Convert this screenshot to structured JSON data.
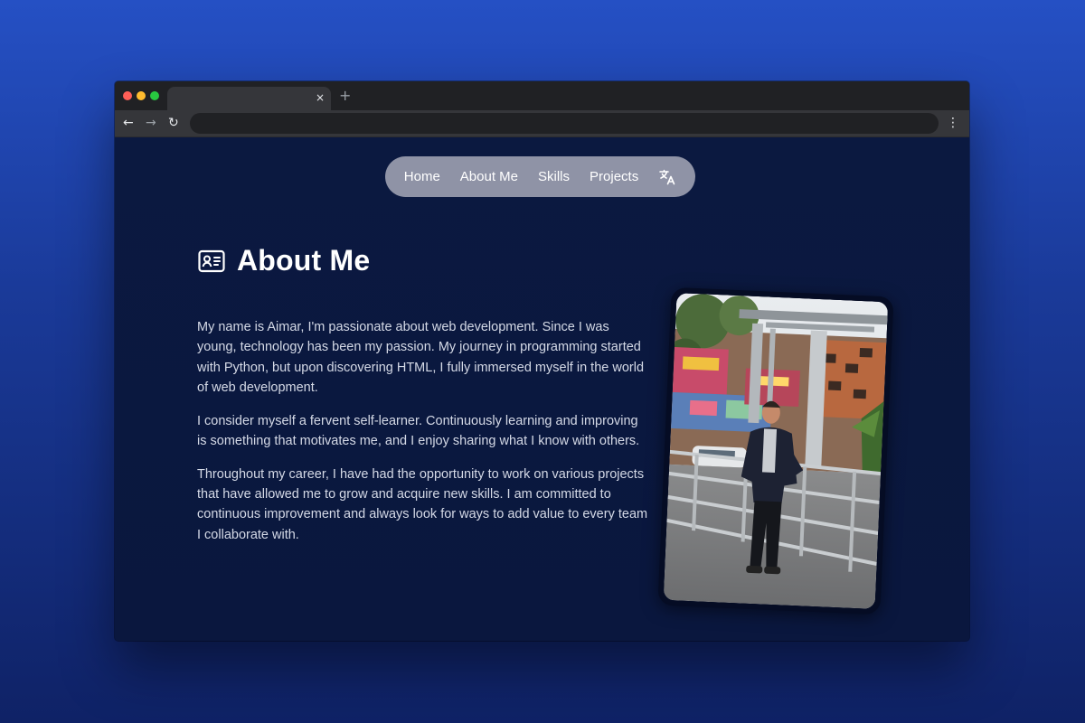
{
  "browser": {
    "tab_close_glyph": "×",
    "new_tab_glyph": "+",
    "back_glyph": "←",
    "forward_glyph": "→",
    "reload_glyph": "↻",
    "menu_glyph": "⋮"
  },
  "nav": {
    "items": [
      {
        "label": "Home"
      },
      {
        "label": "About Me"
      },
      {
        "label": "Skills"
      },
      {
        "label": "Projects"
      }
    ],
    "language_icon": "translate-icon"
  },
  "about": {
    "title": "About Me",
    "title_icon": "id-card-icon",
    "paragraphs": [
      "My name is Aimar, I'm passionate about web development. Since I was young, technology has been my passion. My journey in programming started with Python, but upon discovering HTML, I fully immersed myself in the world of web development.",
      "I consider myself a fervent self-learner. Continuously learning and improving is something that motivates me, and I enjoy sharing what I know with others.",
      "Throughout my career, I have had the opportunity to work on various projects that have allowed me to grow and acquire new skills. I am committed to continuous improvement and always look for ways to add value to every team I collaborate with."
    ]
  },
  "colors": {
    "page_background": "#0b1940",
    "nav_pill": "#8f93a6",
    "heading_text": "#ffffff",
    "body_text": "#d4d9e6"
  }
}
